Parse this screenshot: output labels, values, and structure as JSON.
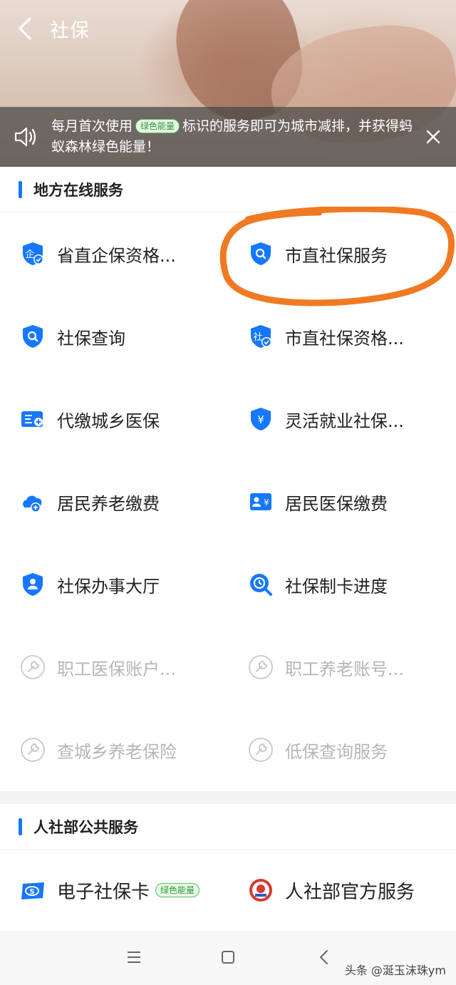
{
  "header": {
    "title": "社保"
  },
  "notice": {
    "text_before": "每月首次使用",
    "tag": "绿色能量",
    "text_after": "标识的服务即可为城市减排，并获得蚂蚁森林绿色能量！"
  },
  "local_services": {
    "title": "地方在线服务",
    "items": [
      {
        "label": "省直企保资格...",
        "icon": "enterprise-shield-icon"
      },
      {
        "label": "市直社保服务",
        "icon": "search-shield-icon"
      },
      {
        "label": "社保查询",
        "icon": "search-shield-icon"
      },
      {
        "label": "市直社保资格...",
        "icon": "qualification-shield-icon"
      },
      {
        "label": "代缴城乡医保",
        "icon": "card-plus-icon"
      },
      {
        "label": "灵活就业社保...",
        "icon": "yuan-shield-icon"
      },
      {
        "label": "居民养老缴费",
        "icon": "cloud-plus-icon"
      },
      {
        "label": "居民医保缴费",
        "icon": "id-card-yuan-icon"
      },
      {
        "label": "社保办事大厅",
        "icon": "person-shield-icon"
      },
      {
        "label": "社保制卡进度",
        "icon": "progress-search-icon"
      },
      {
        "label": "职工医保账户...",
        "icon": "wrench-icon"
      },
      {
        "label": "职工养老账号...",
        "icon": "wrench-icon"
      },
      {
        "label": "查城乡养老保险",
        "icon": "wrench-icon"
      },
      {
        "label": "低保查询服务",
        "icon": "wrench-icon"
      }
    ]
  },
  "public_services": {
    "title": "人社部公共服务",
    "items": [
      {
        "label": "电子社保卡",
        "tag": "绿色能量",
        "icon": "social-security-card-icon"
      },
      {
        "label": "人社部官方服务",
        "icon": "ministry-emblem-icon"
      }
    ]
  },
  "watermark": "头条 @涎玉沫珠ym",
  "colors": {
    "accent": "#1677ff",
    "annotation": "#f07a22",
    "green_tag": "#58c25a"
  }
}
